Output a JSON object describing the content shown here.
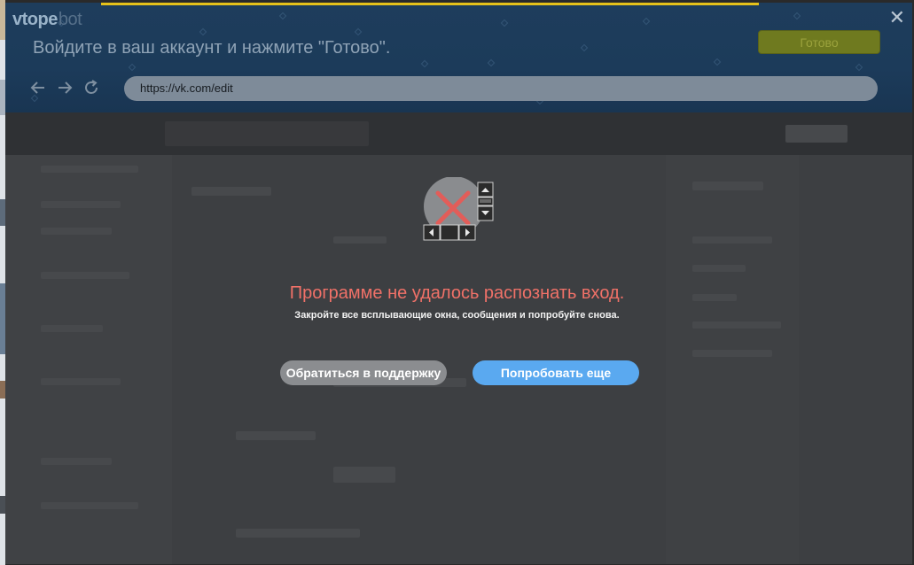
{
  "app": {
    "logo_main": "vtope",
    "logo_sub": "bot",
    "instruction": "Войдите в ваш аккаунт и нажмите \"Готово\".",
    "done_label": "Готово",
    "close_glyph": "✕",
    "url": "https://vk.com/edit",
    "nav_icons": [
      "back-arrow-icon",
      "forward-arrow-icon",
      "reload-icon"
    ]
  },
  "dialog": {
    "icon": "error-cross-icon",
    "title": "Программе не удалось распознать вход.",
    "subtitle": "Закройте все всплывающие окна, сообщения и попробуйте снова.",
    "support_label": "Обратиться в поддержку",
    "retry_label": "Попробовать еще"
  },
  "colors": {
    "header_bg": "#1e3d5c",
    "done_button": "#6f7a1f",
    "error_text": "#f07168",
    "retry_button": "#5aa9f0",
    "support_button": "#8b8d90",
    "overlay": "#3b3d40"
  }
}
